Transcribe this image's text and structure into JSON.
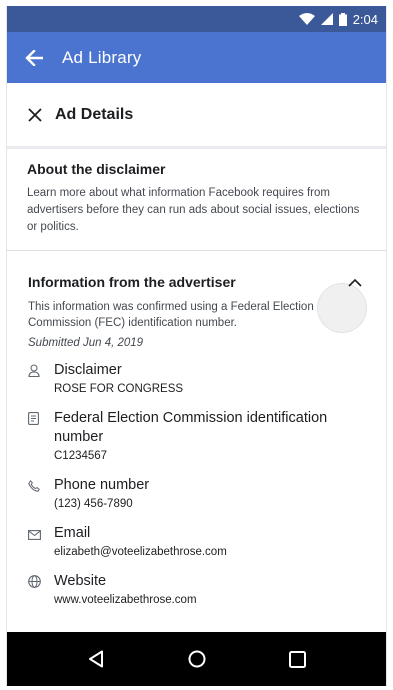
{
  "status_bar": {
    "time": "2:04"
  },
  "app_bar": {
    "title": "Ad Library"
  },
  "details": {
    "title": "Ad Details"
  },
  "disclaimer": {
    "heading": "About the disclaimer",
    "text": "Learn more about what information Facebook requires from advertisers before they can run ads about social issues, elections or politics."
  },
  "advertiser": {
    "heading": "Information from the advertiser",
    "description": "This information was confirmed using a Federal Election Commission (FEC) identification number.",
    "submitted": "Submitted Jun 4, 2019",
    "items": [
      {
        "icon": "person-icon",
        "label": "Disclaimer",
        "value": "ROSE FOR CONGRESS"
      },
      {
        "icon": "document-icon",
        "label": "Federal Election Commission identification number",
        "value": "C1234567"
      },
      {
        "icon": "phone-icon",
        "label": "Phone number",
        "value": "(123) 456-7890"
      },
      {
        "icon": "email-icon",
        "label": "Email",
        "value": "elizabeth@voteelizabethrose.com"
      },
      {
        "icon": "globe-icon",
        "label": "Website",
        "value": "www.voteelizabethrose.com"
      }
    ]
  },
  "colors": {
    "status_bar": "#3b5998",
    "app_bar": "#4a74cf",
    "nav_bar": "#000000"
  }
}
